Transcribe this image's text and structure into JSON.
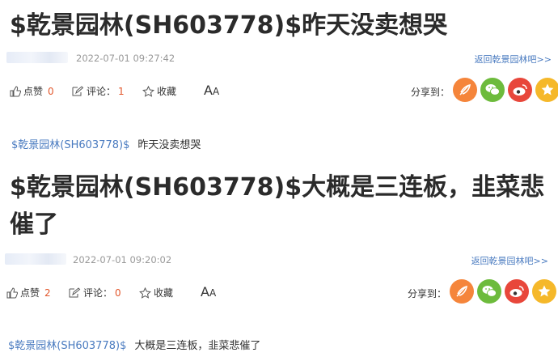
{
  "posts": [
    {
      "title": "$乾景园林(SH603778)$昨天没卖想哭",
      "time": "2022-07-01 09:27:42",
      "back_link": "返回乾景园林吧>>",
      "like_label": "点赞",
      "like_count": "0",
      "comment_label": "评论：",
      "comment_count": "1",
      "favorite_label": "收藏",
      "font_size_label": "A",
      "share_label": "分享到：",
      "stock_tag": "$乾景园林(SH603778)$",
      "body": "昨天没卖想哭"
    },
    {
      "title_line1": "$乾景园林(SH603778)$大概是三连板，韭菜悲",
      "title_line2": "催了",
      "time": "2022-07-01 09:20:02",
      "back_link": "返回乾景园林吧>>",
      "like_label": "点赞",
      "like_count": "2",
      "comment_label": "评论：",
      "comment_count": "0",
      "favorite_label": "收藏",
      "font_size_label": "A",
      "share_label": "分享到：",
      "stock_tag": "$乾景园林(SH603778)$",
      "body": "大概是三连板，韭菜悲催了"
    }
  ],
  "share_icons": [
    {
      "name": "share-icon-1",
      "color": "#f5853b"
    },
    {
      "name": "share-icon-wechat",
      "color": "#6dbb3c"
    },
    {
      "name": "share-icon-weibo",
      "color": "#e8473b"
    },
    {
      "name": "share-icon-qzone",
      "color": "#f5b82a"
    }
  ]
}
